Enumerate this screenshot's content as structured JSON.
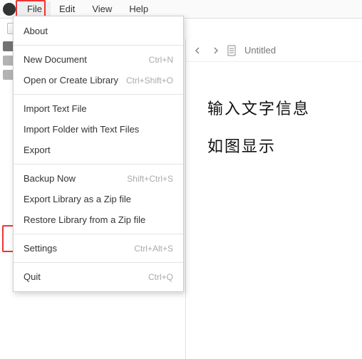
{
  "menubar": {
    "items": [
      "File",
      "Edit",
      "View",
      "Help"
    ],
    "active_index": 0
  },
  "dropdown": {
    "groups": [
      [
        {
          "label": "About",
          "shortcut": ""
        }
      ],
      [
        {
          "label": "New Document",
          "shortcut": "Ctrl+N"
        },
        {
          "label": "Open or Create Library",
          "shortcut": "Ctrl+Shift+O"
        }
      ],
      [
        {
          "label": "Import Text File",
          "shortcut": ""
        },
        {
          "label": "Import Folder with Text Files",
          "shortcut": ""
        },
        {
          "label": "Export",
          "shortcut": ""
        }
      ],
      [
        {
          "label": "Backup Now",
          "shortcut": "Shift+Ctrl+S"
        },
        {
          "label": "Export Library as a Zip file",
          "shortcut": ""
        },
        {
          "label": "Restore Library from a Zip file",
          "shortcut": ""
        }
      ],
      [
        {
          "label": "Settings",
          "shortcut": "Ctrl+Alt+S"
        }
      ],
      [
        {
          "label": "Quit",
          "shortcut": "Ctrl+Q"
        }
      ]
    ]
  },
  "tab": {
    "title": "Untitled"
  },
  "doc": {
    "line1": "输入文字信息",
    "line2": "如图显示"
  },
  "highlight_targets": {
    "menu": "File",
    "item": "Settings"
  }
}
